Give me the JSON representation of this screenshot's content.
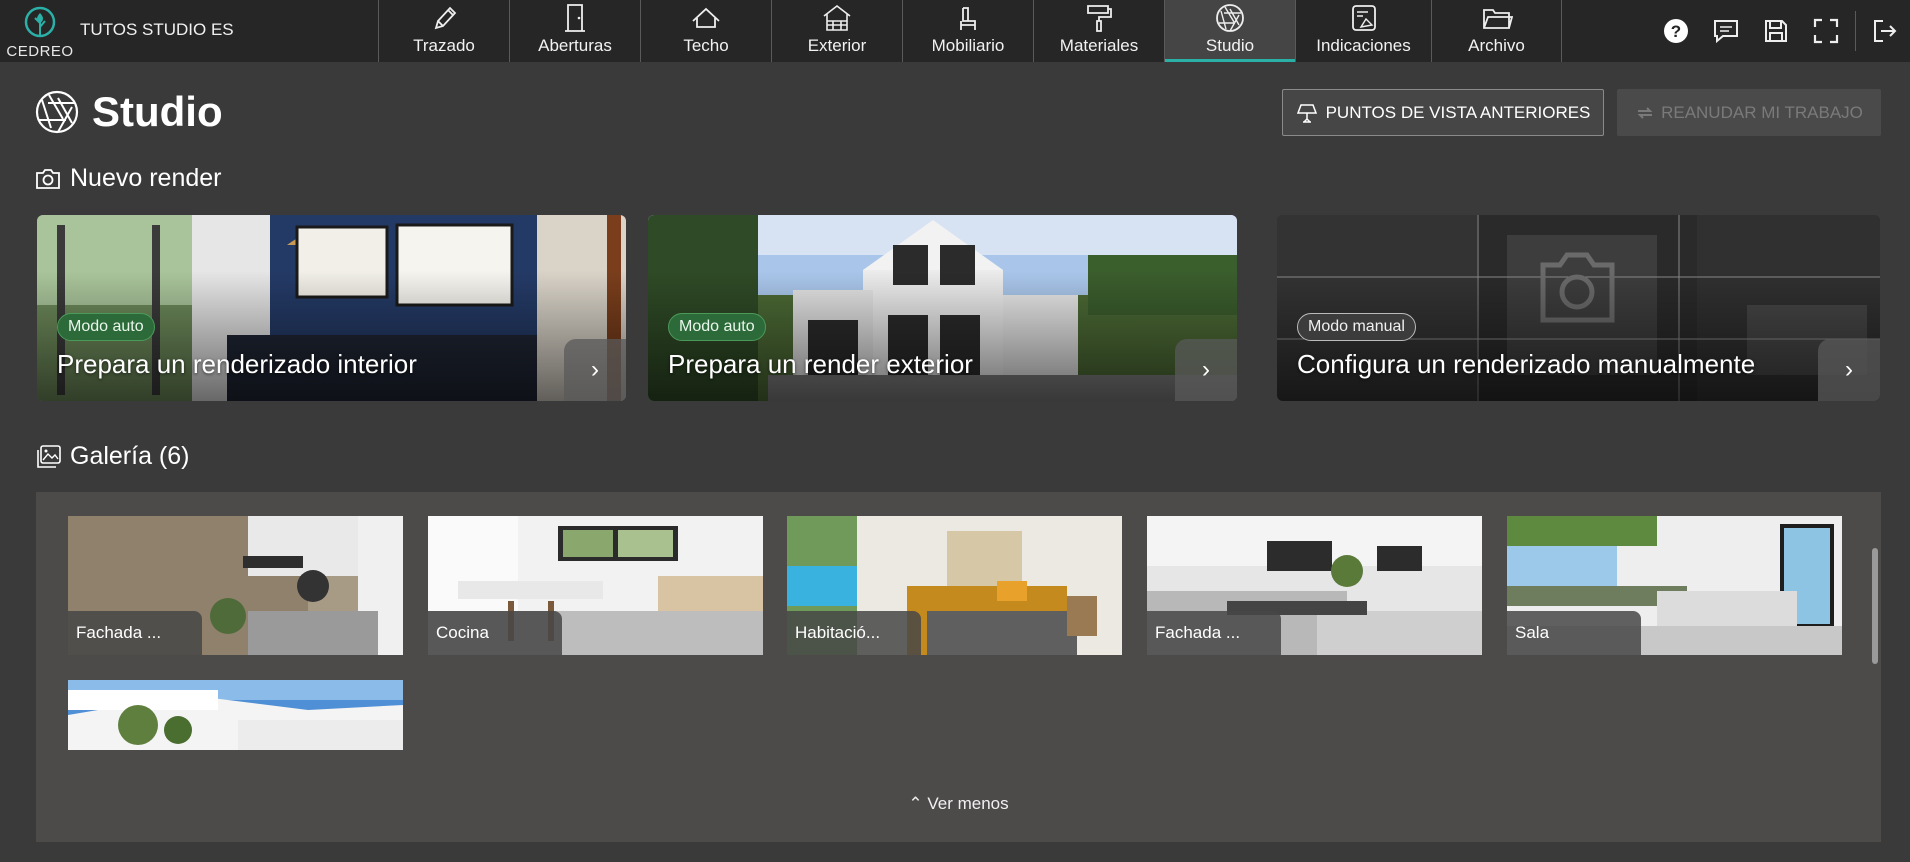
{
  "app": {
    "logo_text": "CEDREO",
    "project_name": "TUTOS STUDIO ES"
  },
  "nav": {
    "items": [
      {
        "label": "Trazado",
        "icon": "pencil-icon"
      },
      {
        "label": "Aberturas",
        "icon": "door-icon"
      },
      {
        "label": "Techo",
        "icon": "roof-icon"
      },
      {
        "label": "Exterior",
        "icon": "house-exterior-icon"
      },
      {
        "label": "Mobiliario",
        "icon": "chair-icon"
      },
      {
        "label": "Materiales",
        "icon": "paint-roller-icon"
      },
      {
        "label": "Studio",
        "icon": "aperture-icon",
        "active": true
      },
      {
        "label": "Indicaciones",
        "icon": "annotation-icon"
      },
      {
        "label": "Archivo",
        "icon": "folder-icon"
      }
    ]
  },
  "top_actions": [
    "help-icon",
    "comments-icon",
    "save-icon",
    "fullscreen-icon",
    "logout-icon"
  ],
  "header": {
    "title": "Studio",
    "prev_views_label": "PUNTOS DE VISTA ANTERIORES",
    "resume_label": "REANUDAR MI TRABAJO"
  },
  "new_render": {
    "title": "Nuevo render",
    "cards": [
      {
        "badge": "Modo auto",
        "title": "Prepara un renderizado interior"
      },
      {
        "badge": "Modo auto",
        "title": "Prepara un render exterior"
      },
      {
        "badge": "Modo manual",
        "title": "Configura un renderizado manualmente"
      }
    ]
  },
  "gallery": {
    "title": "Galería (6)",
    "items": [
      {
        "label": "Fachada ..."
      },
      {
        "label": "Cocina"
      },
      {
        "label": "Habitació..."
      },
      {
        "label": "Fachada ..."
      },
      {
        "label": "Sala"
      },
      {
        "label": ""
      }
    ],
    "toggle_label": "Ver menos"
  },
  "colors": {
    "accent": "#2bb0a8",
    "topbar": "#262626",
    "background": "#3b3a3a",
    "auto_badge": "#2d6a3a"
  }
}
